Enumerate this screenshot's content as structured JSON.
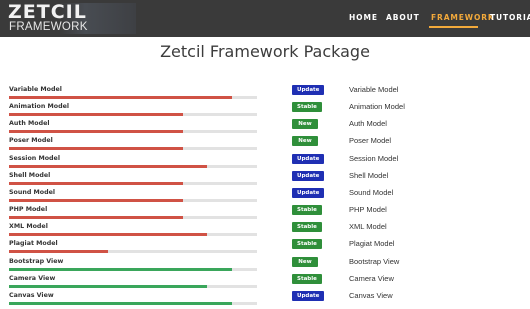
{
  "header": {
    "logo_top": "ZETCIL",
    "logo_bottom": "FRAMEWORK",
    "nav": [
      "HOME",
      "ABOUT",
      "FRAMEWORK",
      "TUTORIAL"
    ],
    "active_nav": "FRAMEWORK"
  },
  "page_title": "Zetcil Framework Package",
  "colors": {
    "nav_bg": "#3a3a3a",
    "accent": "#f2a93b",
    "model_bar": "#d05245",
    "view_bar": "#3aa65b",
    "track": "#e2e2e2",
    "badge_update": "#1f2fb3",
    "badge_stable": "#2f8f3a",
    "badge_new": "#2f8f3a"
  },
  "packages": [
    {
      "name": "Variable Model",
      "progress": 0.9,
      "bar": "model",
      "badge": "Update",
      "label": "Variable Model"
    },
    {
      "name": "Animation Model",
      "progress": 0.7,
      "bar": "model",
      "badge": "Stable",
      "label": "Animation Model"
    },
    {
      "name": "Auth Model",
      "progress": 0.7,
      "bar": "model",
      "badge": "New",
      "label": "Auth Model"
    },
    {
      "name": "Poser Model",
      "progress": 0.7,
      "bar": "model",
      "badge": "New",
      "label": "Poser Model"
    },
    {
      "name": "Session Model",
      "progress": 0.8,
      "bar": "model",
      "badge": "Update",
      "label": "Session Model"
    },
    {
      "name": "Shell Model",
      "progress": 0.7,
      "bar": "model",
      "badge": "Update",
      "label": "Shell Model"
    },
    {
      "name": "Sound Model",
      "progress": 0.7,
      "bar": "model",
      "badge": "Update",
      "label": "Sound Model"
    },
    {
      "name": "PHP Model",
      "progress": 0.7,
      "bar": "model",
      "badge": "Stable",
      "label": "PHP Model"
    },
    {
      "name": "XML Model",
      "progress": 0.8,
      "bar": "model",
      "badge": "Stable",
      "label": "XML Model"
    },
    {
      "name": "Plagiat Model",
      "progress": 0.4,
      "bar": "model",
      "badge": "Stable",
      "label": "Plagiat Model"
    },
    {
      "name": "Bootstrap View",
      "progress": 0.9,
      "bar": "view",
      "badge": "New",
      "label": "Bootstrap View"
    },
    {
      "name": "Camera View",
      "progress": 0.8,
      "bar": "view",
      "badge": "Stable",
      "label": "Camera View"
    },
    {
      "name": "Canvas View",
      "progress": 0.9,
      "bar": "view",
      "badge": "Update",
      "label": "Canvas View"
    }
  ]
}
